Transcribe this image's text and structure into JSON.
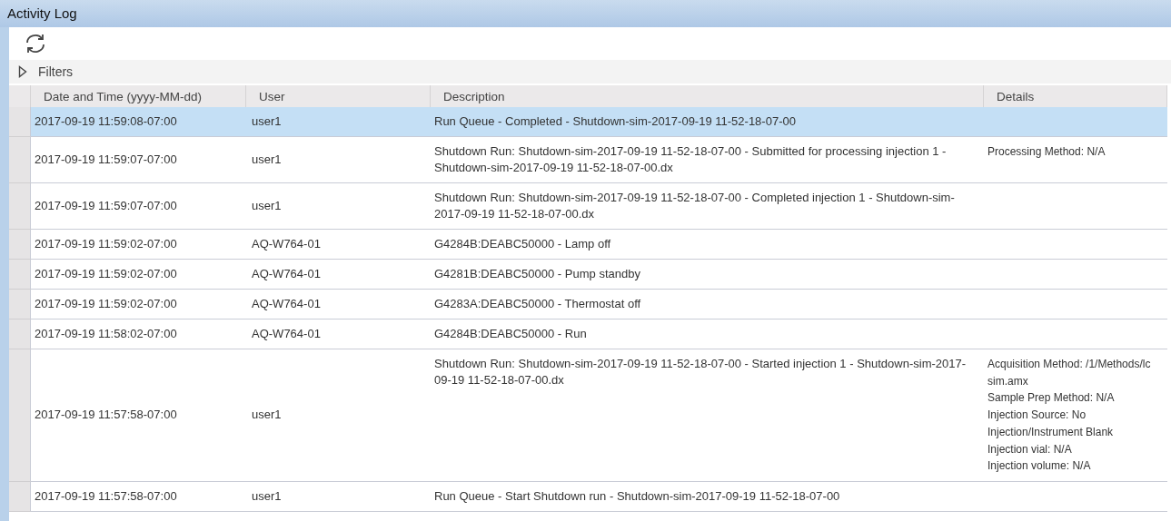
{
  "window": {
    "title": "Activity Log"
  },
  "filters": {
    "label": "Filters",
    "expanded": false
  },
  "table": {
    "columns": [
      "Date and Time (yyyy-MM-dd)",
      "User",
      "Description",
      "Details"
    ],
    "rows": [
      {
        "selected": true,
        "date": "2017-09-19 11:59:08-07:00",
        "user": "user1",
        "description": "Run Queue - Completed  - Shutdown-sim-2017-09-19 11-52-18-07-00",
        "details": []
      },
      {
        "selected": false,
        "date": "2017-09-19 11:59:07-07:00",
        "user": "user1",
        "description": "Shutdown Run: Shutdown-sim-2017-09-19 11-52-18-07-00 - Submitted for processing injection 1 - Shutdown-sim-2017-09-19 11-52-18-07-00.dx",
        "details": [
          "Processing Method: N/A"
        ]
      },
      {
        "selected": false,
        "date": "2017-09-19 11:59:07-07:00",
        "user": "user1",
        "description": "Shutdown Run: Shutdown-sim-2017-09-19 11-52-18-07-00 - Completed injection 1 - Shutdown-sim-2017-09-19 11-52-18-07-00.dx",
        "details": []
      },
      {
        "selected": false,
        "date": "2017-09-19 11:59:02-07:00",
        "user": "AQ-W764-01",
        "description": "G4284B:DEABC50000 - Lamp off",
        "details": []
      },
      {
        "selected": false,
        "date": "2017-09-19 11:59:02-07:00",
        "user": "AQ-W764-01",
        "description": "G4281B:DEABC50000 - Pump standby",
        "details": []
      },
      {
        "selected": false,
        "date": "2017-09-19 11:59:02-07:00",
        "user": "AQ-W764-01",
        "description": "G4283A:DEABC50000 - Thermostat off",
        "details": []
      },
      {
        "selected": false,
        "date": "2017-09-19 11:58:02-07:00",
        "user": "AQ-W764-01",
        "description": "G4284B:DEABC50000 - Run",
        "details": []
      },
      {
        "selected": false,
        "date": "2017-09-19 11:57:58-07:00",
        "user": "user1",
        "description": "Shutdown Run: Shutdown-sim-2017-09-19 11-52-18-07-00 - Started injection 1 - Shutdown-sim-2017-09-19 11-52-18-07-00.dx",
        "details": [
          "Acquisition Method: /1/Methods/lc sim.amx",
          "Sample Prep Method: N/A",
          "Injection Source: No Injection/Instrument Blank",
          "Injection vial: N/A",
          "Injection volume: N/A"
        ]
      },
      {
        "selected": false,
        "date": "2017-09-19 11:57:58-07:00",
        "user": "user1",
        "description": "Run Queue - Start Shutdown run - Shutdown-sim-2017-09-19 11-52-18-07-00",
        "details": []
      }
    ]
  }
}
